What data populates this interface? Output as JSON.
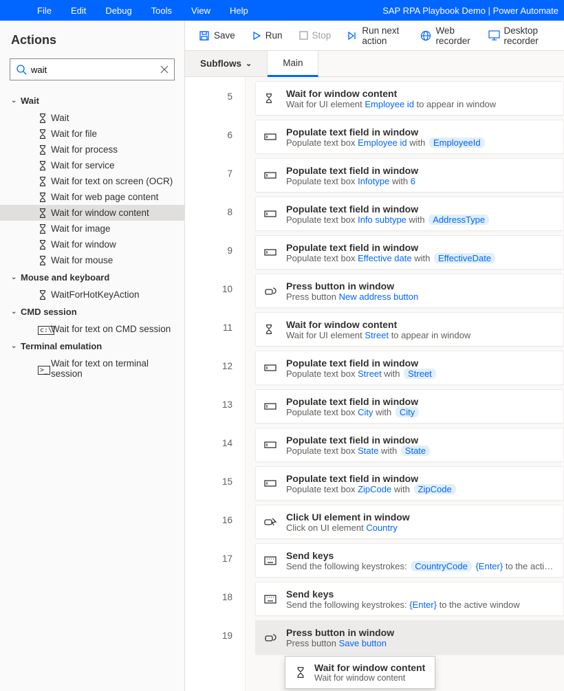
{
  "app_title": "SAP RPA Playbook Demo | Power Automate",
  "menu": [
    "File",
    "Edit",
    "Debug",
    "Tools",
    "View",
    "Help"
  ],
  "actions": {
    "header": "Actions",
    "search_value": "wait",
    "groups": [
      {
        "label": "Wait",
        "items": [
          {
            "icon": "hourglass",
            "label": "Wait"
          },
          {
            "icon": "hourglass",
            "label": "Wait for file"
          },
          {
            "icon": "hourglass",
            "label": "Wait for process"
          },
          {
            "icon": "hourglass",
            "label": "Wait for service"
          },
          {
            "icon": "hourglass",
            "label": "Wait for text on screen (OCR)"
          },
          {
            "icon": "hourglass",
            "label": "Wait for web page content"
          },
          {
            "icon": "hourglass",
            "label": "Wait for window content",
            "selected": true
          },
          {
            "icon": "hourglass",
            "label": "Wait for image"
          },
          {
            "icon": "hourglass",
            "label": "Wait for window"
          },
          {
            "icon": "hourglass",
            "label": "Wait for mouse"
          }
        ]
      },
      {
        "label": "Mouse and keyboard",
        "items": [
          {
            "icon": "hourglass",
            "label": "WaitForHotKeyAction"
          }
        ]
      },
      {
        "label": "CMD session",
        "items": [
          {
            "icon": "cmd",
            "label": "Wait for text on CMD session"
          }
        ]
      },
      {
        "label": "Terminal emulation",
        "items": [
          {
            "icon": "term",
            "label": "Wait for text on terminal session"
          }
        ]
      }
    ]
  },
  "toolbar": {
    "save": "Save",
    "run": "Run",
    "stop": "Stop",
    "run_next": "Run next action",
    "web_rec": "Web recorder",
    "desktop_rec": "Desktop recorder"
  },
  "tabs": {
    "subflows": "Subflows",
    "main": "Main"
  },
  "steps": [
    {
      "num": "5",
      "icon": "hourglass",
      "title": "Wait for window content",
      "desc": [
        {
          "t": "Wait for UI element "
        },
        {
          "link": "Employee id"
        },
        {
          "t": " to appear in window"
        }
      ]
    },
    {
      "num": "6",
      "icon": "textbox",
      "title": "Populate text field in window",
      "desc": [
        {
          "t": "Populate text box "
        },
        {
          "link": "Employee id"
        },
        {
          "t": " with "
        },
        {
          "pill": "EmployeeId"
        }
      ]
    },
    {
      "num": "7",
      "icon": "textbox",
      "title": "Populate text field in window",
      "desc": [
        {
          "t": "Populate text box "
        },
        {
          "link": "Infotype"
        },
        {
          "t": " with "
        },
        {
          "link": "6"
        }
      ]
    },
    {
      "num": "8",
      "icon": "textbox",
      "title": "Populate text field in window",
      "desc": [
        {
          "t": "Populate text box "
        },
        {
          "link": "Info subtype"
        },
        {
          "t": " with "
        },
        {
          "pill": "AddressType"
        }
      ]
    },
    {
      "num": "9",
      "icon": "textbox",
      "title": "Populate text field in window",
      "desc": [
        {
          "t": "Populate text box "
        },
        {
          "link": "Effective date"
        },
        {
          "t": " with "
        },
        {
          "pill": "EffectiveDate"
        }
      ]
    },
    {
      "num": "10",
      "icon": "press",
      "title": "Press button in window",
      "desc": [
        {
          "t": "Press button "
        },
        {
          "link": "New address button"
        }
      ]
    },
    {
      "num": "11",
      "icon": "hourglass",
      "title": "Wait for window content",
      "desc": [
        {
          "t": "Wait for UI element "
        },
        {
          "link": "Street"
        },
        {
          "t": " to appear in window"
        }
      ]
    },
    {
      "num": "12",
      "icon": "textbox",
      "title": "Populate text field in window",
      "desc": [
        {
          "t": "Populate text box "
        },
        {
          "link": "Street"
        },
        {
          "t": " with "
        },
        {
          "pill": "Street"
        }
      ]
    },
    {
      "num": "13",
      "icon": "textbox",
      "title": "Populate text field in window",
      "desc": [
        {
          "t": "Populate text box "
        },
        {
          "link": "City"
        },
        {
          "t": " with "
        },
        {
          "pill": "City"
        }
      ]
    },
    {
      "num": "14",
      "icon": "textbox",
      "title": "Populate text field in window",
      "desc": [
        {
          "t": "Populate text box "
        },
        {
          "link": "State"
        },
        {
          "t": " with "
        },
        {
          "pill": "State"
        }
      ]
    },
    {
      "num": "15",
      "icon": "textbox",
      "title": "Populate text field in window",
      "desc": [
        {
          "t": "Populate text box "
        },
        {
          "link": "ZipCode"
        },
        {
          "t": " with "
        },
        {
          "pill": "ZipCode"
        }
      ]
    },
    {
      "num": "16",
      "icon": "click",
      "title": "Click UI element in window",
      "desc": [
        {
          "t": "Click on UI element "
        },
        {
          "link": "Country"
        }
      ]
    },
    {
      "num": "17",
      "icon": "keyboard",
      "title": "Send keys",
      "desc": [
        {
          "t": "Send the following keystrokes: "
        },
        {
          "pill": "CountryCode"
        },
        {
          "t": " "
        },
        {
          "link": "{Enter}"
        },
        {
          "t": " to the active window"
        }
      ]
    },
    {
      "num": "18",
      "icon": "keyboard",
      "title": "Send keys",
      "desc": [
        {
          "t": "Send the following keystrokes: "
        },
        {
          "link": "{Enter}"
        },
        {
          "t": " to the active window"
        }
      ]
    },
    {
      "num": "19",
      "icon": "press",
      "title": "Press button in window",
      "desc": [
        {
          "t": "Press button "
        },
        {
          "link": "Save button"
        }
      ],
      "selected": true
    }
  ],
  "tooltip": {
    "title": "Wait for window content",
    "sub": "Wait for window content"
  }
}
